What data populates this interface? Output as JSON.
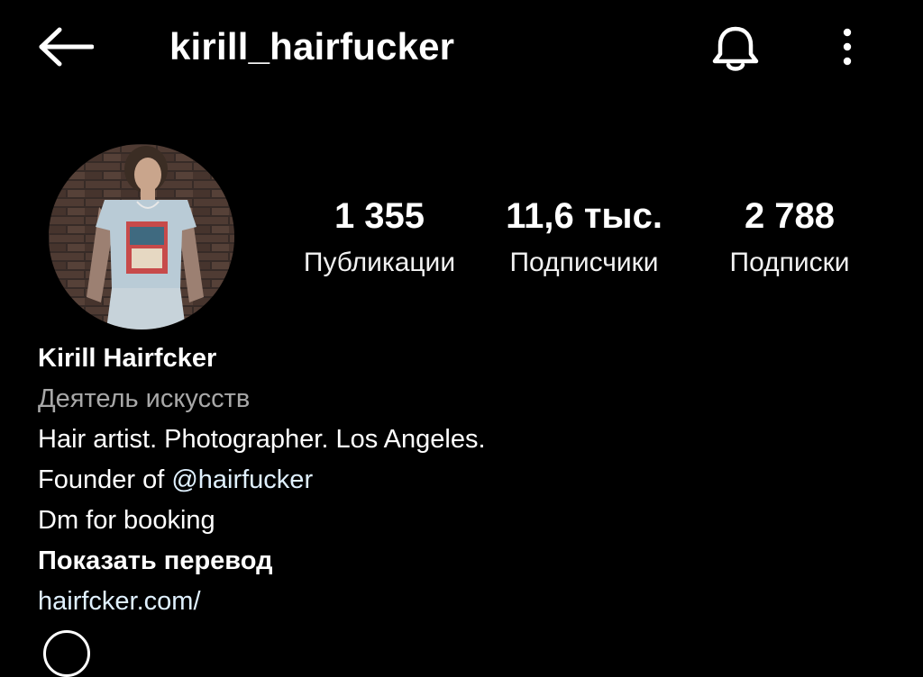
{
  "header": {
    "username": "kirill_hairfucker",
    "icons": [
      "back-arrow-icon",
      "bell-icon",
      "more-vertical-icon"
    ]
  },
  "stats": {
    "posts": {
      "value": "1 355",
      "label": "Публикации"
    },
    "followers": {
      "value": "11,6 тыс.",
      "label": "Подписчики"
    },
    "following": {
      "value": "2 788",
      "label": "Подписки"
    }
  },
  "bio": {
    "name": "Kirill Hairfcker",
    "category": "Деятель искусств",
    "line1": "Hair artist. Photographer. Los Angeles.",
    "line2_prefix": "Founder of ",
    "line2_mention": "@hairfucker",
    "line3": "Dm for booking",
    "translate": "Показать перевод",
    "link": "hairfcker.com/"
  },
  "colors": {
    "background": "#000000",
    "text": "#ffffff",
    "secondary_text": "#a8a8a8",
    "link": "#e0f1ff"
  }
}
